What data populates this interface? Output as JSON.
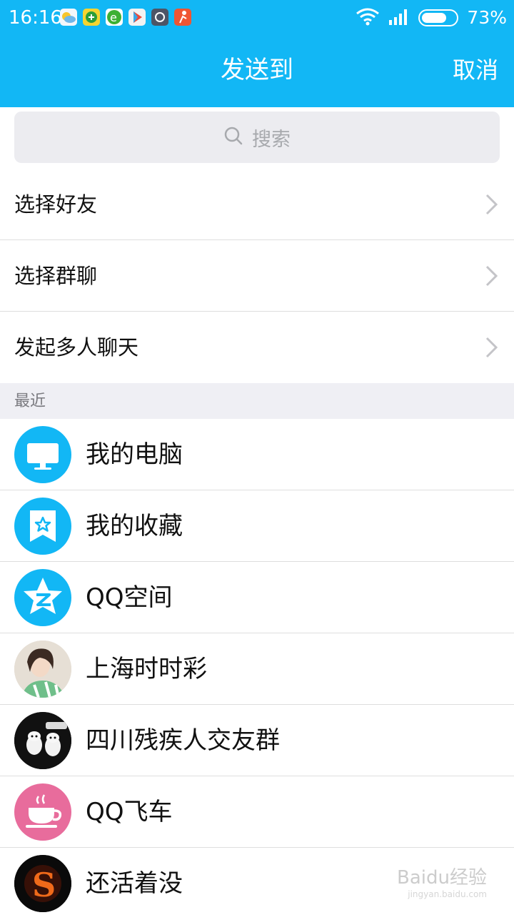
{
  "status_bar": {
    "time": "16:16",
    "battery_percent": "73%",
    "battery_level": 0.73,
    "notification_icons": [
      "weather-icon",
      "app-icon",
      "browser-icon",
      "play-store-icon",
      "app-icon",
      "sports-app-icon"
    ]
  },
  "header": {
    "title": "发送到",
    "cancel_label": "取消"
  },
  "search": {
    "placeholder": "搜索"
  },
  "options": [
    {
      "label": "选择好友"
    },
    {
      "label": "选择群聊"
    },
    {
      "label": "发起多人聊天"
    }
  ],
  "recent": {
    "section_label": "最近",
    "items": [
      {
        "name": "我的电脑",
        "icon": "computer-icon"
      },
      {
        "name": "我的收藏",
        "icon": "favorites-icon"
      },
      {
        "name": "QQ空间",
        "icon": "qzone-icon"
      },
      {
        "name": "上海时时彩",
        "icon": "avatar-photo"
      },
      {
        "name": "四川残疾人交友群",
        "icon": "avatar-photo"
      },
      {
        "name": "QQ飞车",
        "icon": "coffee-cup-icon"
      },
      {
        "name": "还活着没",
        "icon": "avatar-photo"
      }
    ]
  },
  "watermark": {
    "text": "Baidu经验",
    "subtext": "jingyan.baidu.com"
  },
  "colors": {
    "accent": "#12b7f5",
    "section_bg": "#efeff4",
    "divider": "#dedede"
  }
}
